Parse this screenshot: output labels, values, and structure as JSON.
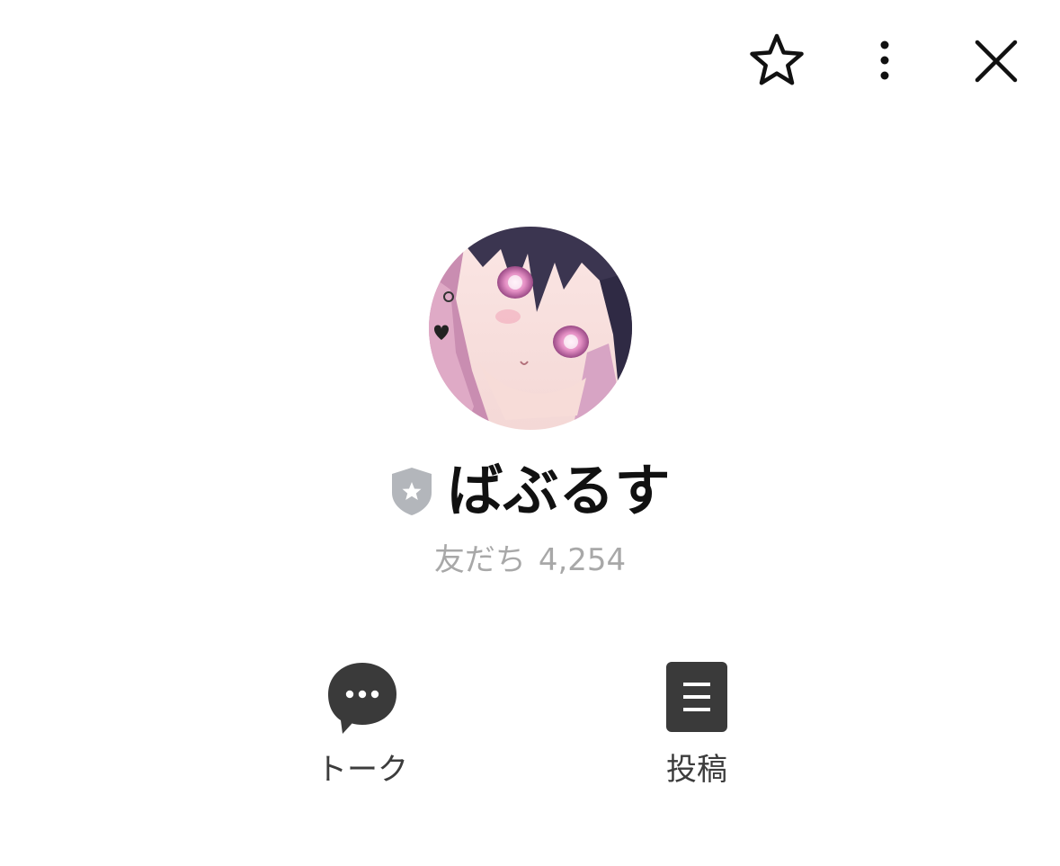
{
  "header": {
    "icons": [
      "star-outline-icon",
      "more-vertical-icon",
      "close-icon"
    ]
  },
  "profile": {
    "name": "ばぶるす",
    "badge_icon": "verified-shield-icon",
    "friends_label": "友だち",
    "friends_count": "4,254"
  },
  "actions": [
    {
      "label": "トーク",
      "icon": "chat-bubble-icon"
    },
    {
      "label": "投稿",
      "icon": "post-list-icon"
    }
  ],
  "colors": {
    "text": "#111111",
    "muted": "#a8a8a8",
    "icon_dark": "#3a3a3a",
    "badge": "#b3b6bb"
  }
}
